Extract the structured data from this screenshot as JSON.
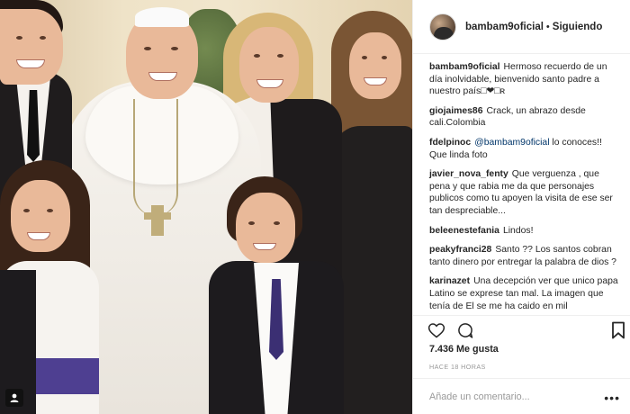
{
  "post": {
    "photo_icon": "user-tag-icon"
  },
  "header": {
    "username": "bambam9oficial",
    "separator": "•",
    "follow_status": "Siguiendo"
  },
  "comments": [
    {
      "user": "bambam9oficial",
      "text": "Hermoso recuerdo de un día inolvidable, bienvenido santo padre a nuestro país□❤□ʀ"
    },
    {
      "user": "giojaimes86",
      "text": "Crack, un abrazo desde cali.Colombia"
    },
    {
      "user": "fdelpinoc",
      "mention": "@bambam9oficial",
      "text": "lo conoces!! Que linda foto"
    },
    {
      "user": "javier_nova_fenty",
      "text": "Que verguenza , que pena y que rabia me da que personajes publicos como tu apoyen la visita de ese ser tan despreciable..."
    },
    {
      "user": "beleenestefania",
      "text": "Lindos!"
    },
    {
      "user": "peakyfranci28",
      "text": "Santo ?? Los santos cobran tanto dinero por entregar la palabra de dios ?"
    },
    {
      "user": "karinazet",
      "text": "Una decepción ver que unico papa Latino se exprese tan mal. La imagen que tenía de El se me ha caido en mil"
    }
  ],
  "actions": {
    "like_icon": "heart-icon",
    "comment_icon": "comment-icon",
    "save_icon": "bookmark-icon"
  },
  "likes": "7.436 Me gusta",
  "timestamp": "HACE 18 HORAS",
  "add_comment": {
    "placeholder": "Añade un comentario...",
    "more_label": "•••"
  }
}
